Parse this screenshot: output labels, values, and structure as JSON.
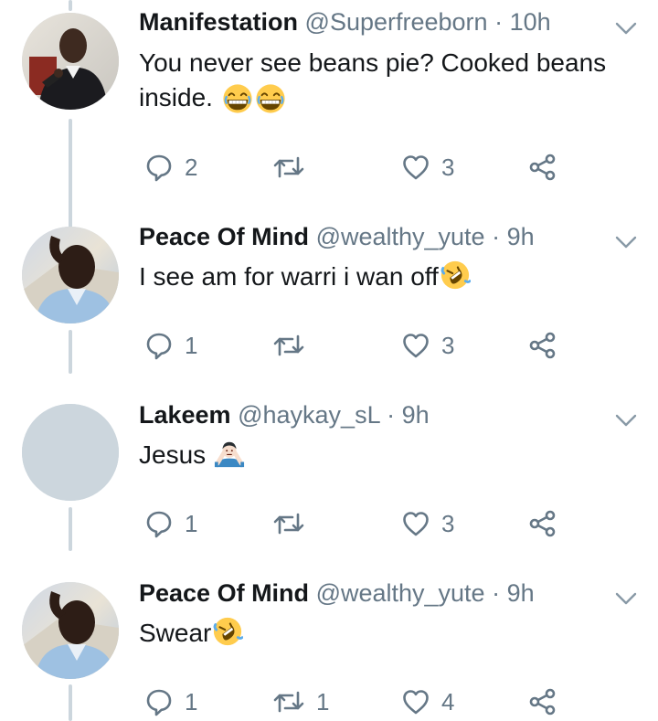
{
  "colors": {
    "text": "#14171a",
    "muted": "#657786",
    "thread_line": "#ccd6dd",
    "icon": "#657786"
  },
  "tweets": [
    {
      "display_name": "Manifestation",
      "handle": "@Superfreeborn",
      "separator": "·",
      "time": "10h",
      "text": "You never see beans pie? Cooked beans inside.",
      "emoji": [
        "grinning-squint-emoji",
        "grinning-squint-emoji"
      ],
      "reply_count": "2",
      "retweet_count": "",
      "like_count": "3"
    },
    {
      "display_name": "Peace Of Mind",
      "handle": "@wealthy_yute",
      "separator": "·",
      "time": "9h",
      "text": "I see am for warri i wan off",
      "emoji": [
        "rolling-on-floor-laughing-emoji"
      ],
      "reply_count": "1",
      "retweet_count": "",
      "like_count": "3"
    },
    {
      "display_name": "Lakeem",
      "handle": "@haykay_sL",
      "separator": "·",
      "time": "9h",
      "text": "Jesus",
      "emoji": [
        "person-gesturing-no-emoji"
      ],
      "reply_count": "1",
      "retweet_count": "",
      "like_count": "3"
    },
    {
      "display_name": "Peace Of Mind",
      "handle": "@wealthy_yute",
      "separator": "·",
      "time": "9h",
      "text": "Swear",
      "emoji": [
        "rolling-on-floor-laughing-emoji"
      ],
      "reply_count": "1",
      "retweet_count": "1",
      "like_count": "4"
    }
  ]
}
